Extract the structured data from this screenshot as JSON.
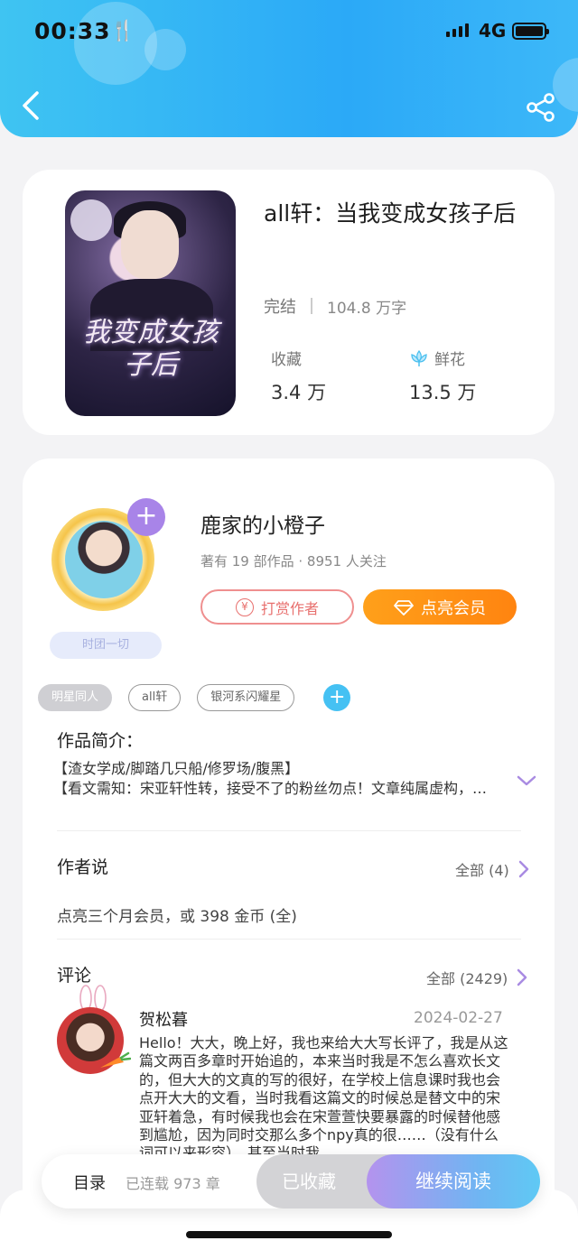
{
  "status_bar": {
    "time": "00:33",
    "network": "4G"
  },
  "book": {
    "title": "all轩：当我变成女孩子后",
    "cover_text": "我变成女孩子后",
    "status": "完结",
    "word_count": "104.8 万字",
    "favorites_label": "收藏",
    "favorites_value": "3.4 万",
    "flowers_label": "鲜花",
    "flowers_value": "13.5 万"
  },
  "author": {
    "name": "鹿家的小橙子",
    "meta": "著有 19 部作品 · 8951 人关注",
    "slogan": "时团一切",
    "reward_label": "打赏作者",
    "reward_icon_text": "¥",
    "vip_label": "点亮会员"
  },
  "tags": [
    "明星同人",
    "all轩",
    "银河系闪耀星"
  ],
  "intro": {
    "heading": "作品简介：",
    "line1": "【渣女学成/脚踏几只船/修罗场/腹黑】",
    "line2": "【看文需知：宋亚轩性转，接受不了的粉丝勿点！文章纯属虚构，请勿上升真人】"
  },
  "author_says": {
    "heading": "作者说",
    "more_label": "全部 (4)",
    "text": "点亮三个月会员，或 398 金币 (全)"
  },
  "comments": {
    "heading": "评论",
    "more_label": "全部 (2429)",
    "items": [
      {
        "user": "贺松暮",
        "date": "2024-02-27",
        "text": "Hello！大大，晚上好，我也来给大大写长评了，我是从这篇文两百多章时开始追的，本来当时我是不怎么喜欢长文的，但大大的文真的写的很好，在学校上信息课时我也会点开大大的文看，当时我看这篇文的时候总是替文中的宋亚轩着急，有时候我也会在宋萱萱快要暴露的时候替他感到尴尬，因为同时交那么多个npy真的很……（没有什么词可以来形容），甚至当时我"
      }
    ]
  },
  "bottom_bar": {
    "toc_label": "目录",
    "serial_label": "已连载 973 章",
    "saved_label": "已收藏",
    "read_label": "继续阅读"
  },
  "colors": {
    "header_blue": "#2ba9f7",
    "vip_orange": "#ff8410",
    "reward_red": "#e8706e",
    "read_gradient_start": "#b493ee",
    "read_gradient_end": "#5fc9f4"
  }
}
